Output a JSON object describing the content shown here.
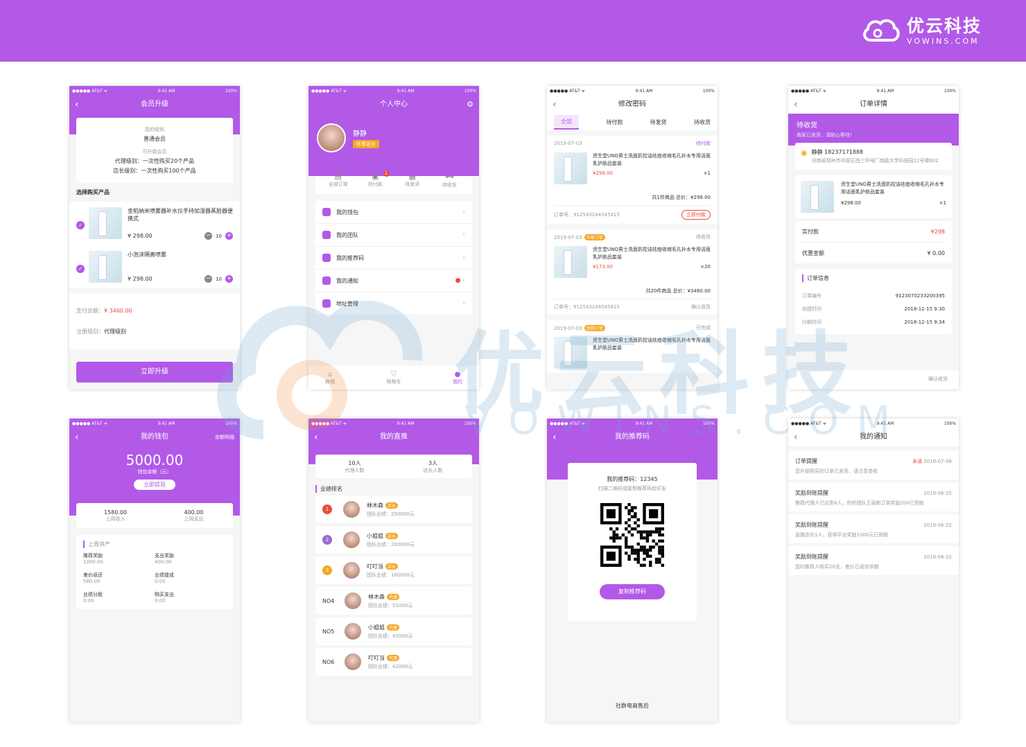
{
  "brand": {
    "name_cn": "优云科技",
    "name_en": "VOWINS.COM"
  },
  "watermark": {
    "cn": "优云科技",
    "en": "VOWINS.COM"
  },
  "status": {
    "carrier": "●●●●● AT&T ᯤ",
    "time": "9:41 AM",
    "battery": "100%"
  },
  "s1": {
    "title": "会员升级",
    "current_label": "您的级别",
    "current_value": "普通会员",
    "up_label": "可升级会员",
    "agent": "代理级别：一次性购买20个产品",
    "store": "店长级别：一次性购买100个产品",
    "choose": "选择购买产品",
    "products": [
      {
        "name": "金稻纳米喷雾器补水仪手持加湿器蒸脸器便携式",
        "price": "¥ 298.00",
        "qty": "10"
      },
      {
        "name": "小泡沫隔离喷雾",
        "price": "¥ 298.00",
        "qty": "10"
      }
    ],
    "total_label": "支付总额：",
    "total_value": "¥ 3460.00",
    "level_label": "注册级别：",
    "level_value": "代理级别",
    "button": "立即升级"
  },
  "s2": {
    "title": "个人中心",
    "name": "静静",
    "badge": "旺季店长",
    "orders": [
      "全部订单",
      "待付款",
      "待发货",
      "待收货"
    ],
    "order_badge": "2",
    "menu": [
      "我的钱包",
      "我的团队",
      "我的推荐码",
      "我的通知",
      "地址管理"
    ],
    "tabs": [
      "商城",
      "购物车",
      "我的"
    ]
  },
  "s3": {
    "title": "修改密码",
    "tabs": [
      "全部",
      "待付款",
      "待发货",
      "待收货"
    ],
    "orders": [
      {
        "date": "2019-07-03",
        "tag": "",
        "status": "待付款",
        "name": "资生堂UNO男士洗面奶控油祛痘收缩毛孔补水专用洁面乳护肤品套装",
        "price": "¥298.00",
        "qty": "×1",
        "summary": "共1件商品  总价：¥298.00",
        "no": "订单号：912543244545415",
        "action": "立即付款"
      },
      {
        "date": "2019-07-03",
        "tag": "升级订单",
        "status": "待收货",
        "name": "资生堂UNO男士洗面奶控油祛痘收缩毛孔补水专用洁面乳护肤品套装",
        "price": "¥173.00",
        "qty": "×20",
        "summary": "共20件商品  总价：¥3460.00",
        "no": "订单号：912543244545415",
        "action": "确认收货"
      },
      {
        "date": "2019-07-03",
        "tag": "团购订单",
        "status": "已完成",
        "name": "资生堂UNO男士洗面奶控油祛痘收缩毛孔补水专用洁面乳护肤品套装"
      }
    ]
  },
  "s4": {
    "title": "订单详情",
    "status": "待收货",
    "status_sub": "商家已发货，请耐心等待！",
    "receiver": "静静 18237171888",
    "address": "河南省郑州市中原区西三环电厂南路大学科技园12号楼602",
    "product": "资生堂UNO男士洗面奶控油祛痘收缩毛孔补水专用洁面乳护肤品套装",
    "price": "¥298.00",
    "qty": "×1",
    "paid_label": "实付款",
    "paid_value": "¥298",
    "discount_label": "优惠金额",
    "discount_value": "¥ 0.00",
    "info_title": "订单信息",
    "info": [
      {
        "k": "订单编号",
        "v": "9123070233200395"
      },
      {
        "k": "创建时间",
        "v": "2018-12-15 9:30"
      },
      {
        "k": "付款时间",
        "v": "2018-12-15 9:34"
      }
    ],
    "confirm": "确认收货"
  },
  "s5": {
    "title": "我的钱包",
    "detail": "余额明细",
    "balance": "5000.00",
    "balance_label": "钱包余额（元）",
    "withdraw": "立即提现",
    "income": "1580.00",
    "income_label": "上周收入",
    "expense": "400.00",
    "expense_label": "上周支出",
    "section": "上周资产",
    "items": [
      {
        "k": "推荐奖励",
        "v": "1000.00"
      },
      {
        "k": "支出奖励",
        "v": "400.00"
      },
      {
        "k": "差价返还",
        "v": "580.00"
      },
      {
        "k": "业绩提成",
        "v": "0.00"
      },
      {
        "k": "业绩分股",
        "v": "0.00"
      },
      {
        "k": "购买支出",
        "v": "0.00"
      }
    ]
  },
  "s6": {
    "title": "我的直推",
    "agents": "10人",
    "agents_label": "代理人数",
    "stores": "3人",
    "stores_label": "店长人数",
    "section": "业绩排名",
    "ranks": [
      {
        "rank": "1",
        "name": "林木森",
        "tag": "店长",
        "perf": "团队业绩：250000元"
      },
      {
        "rank": "2",
        "name": "小姐姐",
        "tag": "店长",
        "perf": "团队业绩：200000元"
      },
      {
        "rank": "3",
        "name": "叮叮当",
        "tag": "店长",
        "perf": "团队业绩：160000元"
      },
      {
        "rank": "NO4",
        "name": "林木森",
        "tag": "代理",
        "perf": "团队业绩：51000元"
      },
      {
        "rank": "NO5",
        "name": "小姐姐",
        "tag": "代理",
        "perf": "团队业绩：45000元"
      },
      {
        "rank": "NO6",
        "name": "叮叮当",
        "tag": "代理",
        "perf": "团队业绩：42000元"
      }
    ]
  },
  "s7": {
    "title": "我的推荐码",
    "code": "我的推荐码：12345",
    "hint": "扫描二维码或复制推荐码给好友",
    "copy": "复制推荐码",
    "footer": "社群电商售后"
  },
  "s8": {
    "title": "我的通知",
    "items": [
      {
        "title": "订单提醒",
        "unread": "未读",
        "date": "2019-07-06",
        "text": "您升级购买的订单已发货，请注意查收"
      },
      {
        "title": "奖励到账提醒",
        "unread": "",
        "date": "2019-06-25",
        "text": "推荐代理人已达到4人，你的团队王丽新订单奖励200已到账"
      },
      {
        "title": "奖励到账提醒",
        "unread": "",
        "date": "2019-06-22",
        "text": "直推店长1人，获得平台奖励1000元已到账"
      },
      {
        "title": "奖励到账提醒",
        "unread": "",
        "date": "2019-06-22",
        "text": "您的推荐人购买20支，差价已返你余额"
      }
    ]
  }
}
